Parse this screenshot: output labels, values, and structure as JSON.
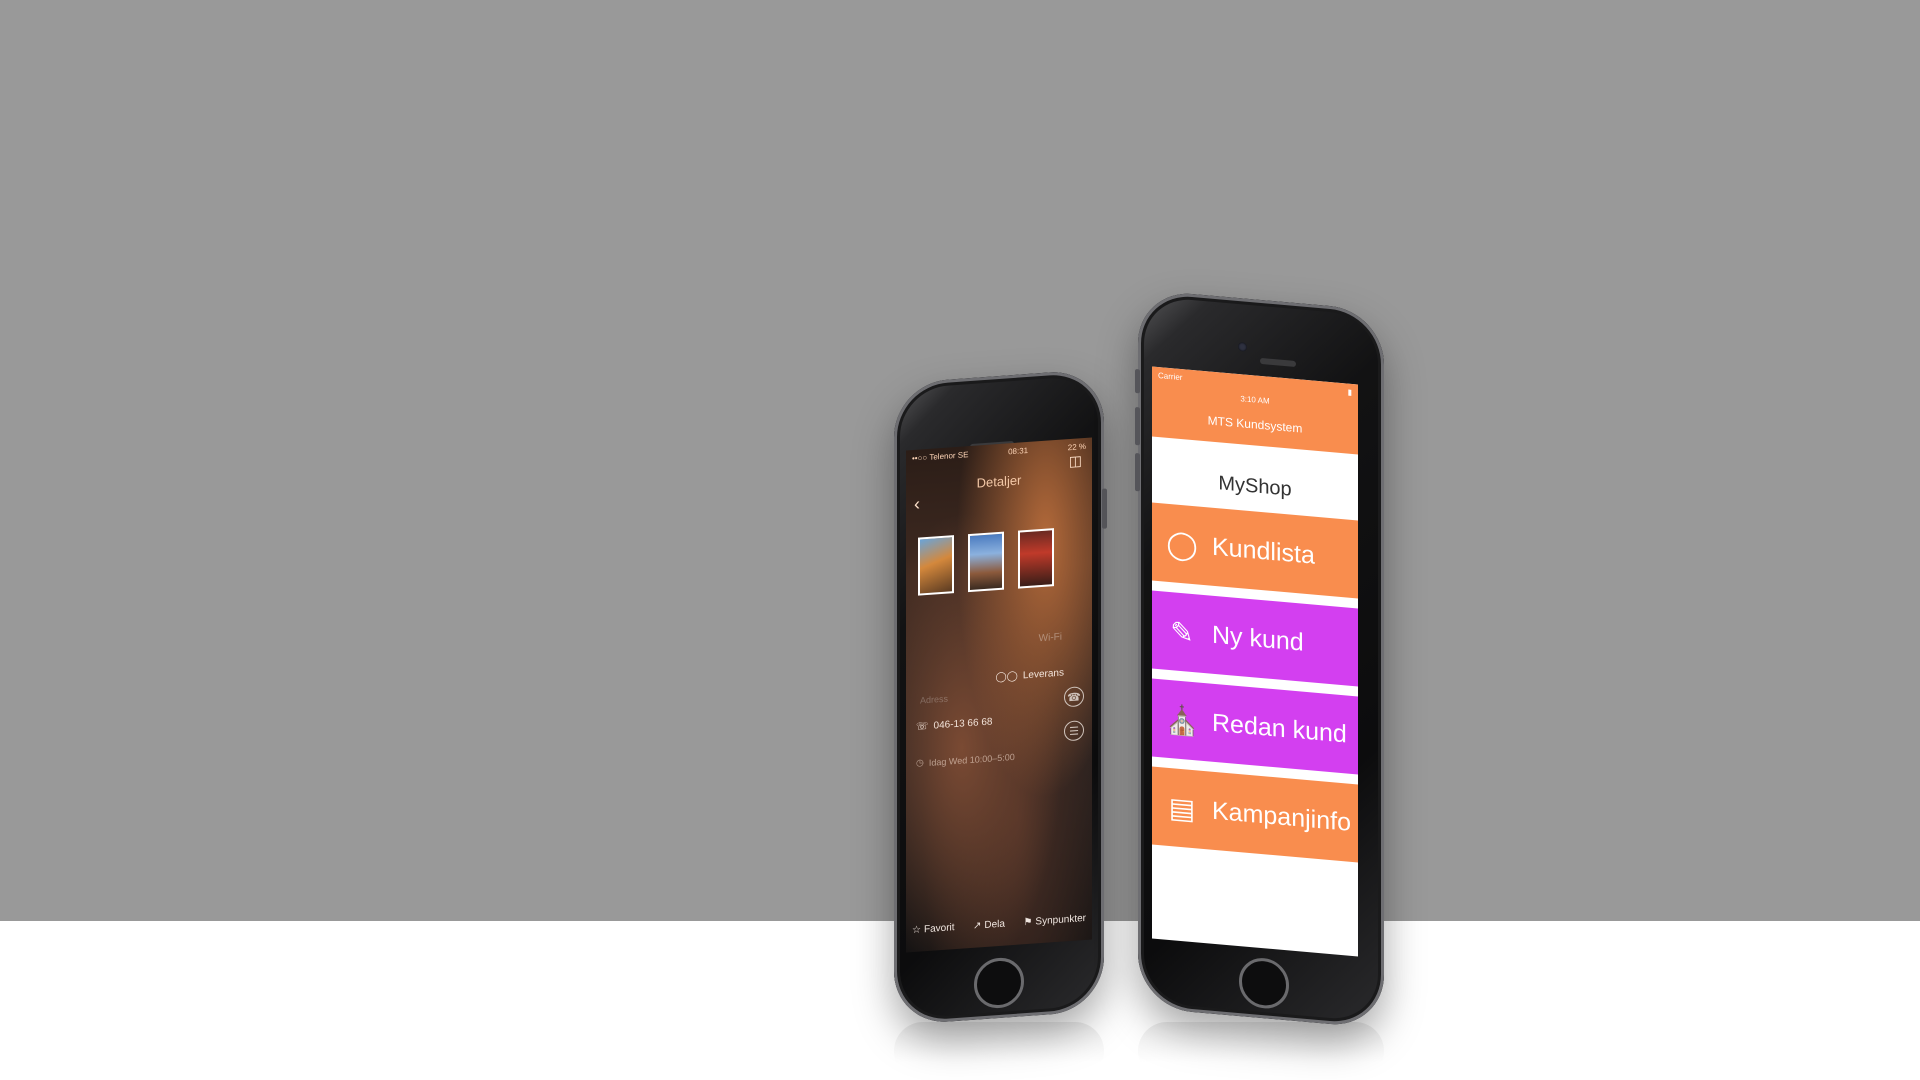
{
  "left_phone": {
    "status_left": "••○○ Telenor SE",
    "status_time": "08:31",
    "status_battery": "22 %",
    "title": "Detaljer",
    "wifi_label": "Wi-Fi",
    "leverans_label": "Leverans",
    "ghost_label": "Adress",
    "phone_number": "046-13 66 68",
    "hours": "Idag Wed 10:00–5:00",
    "toolbar": {
      "favorit": "Favorit",
      "dela": "Dela",
      "synpunkter": "Synpunkter"
    },
    "icons": {
      "back": "chevron-left-icon",
      "book": "book-icon",
      "bike": "bicycle-icon",
      "phone": "phone-icon",
      "clock": "clock-icon",
      "star": "star-icon",
      "share": "share-icon",
      "flag": "flag-icon",
      "call": "call-icon",
      "menu": "list-icon"
    }
  },
  "right_phone": {
    "status_carrier": "Carrier",
    "status_time": "3:10 AM",
    "app_title": "MTS Kundsystem",
    "shop_name": "MyShop",
    "menu": [
      {
        "label": "Kundlista",
        "icon": "user-icon",
        "color": "#f98d4e"
      },
      {
        "label": "Ny kund",
        "icon": "pencil-icon",
        "color": "#d33ff0"
      },
      {
        "label": "Redan kund",
        "icon": "store-icon",
        "color": "#d33ff0"
      },
      {
        "label": "Kampanjinfo",
        "icon": "newspaper-icon",
        "color": "#f98d4e"
      }
    ]
  },
  "colors": {
    "background": "#999999",
    "floor": "#ffffff",
    "accent_orange": "#f98d4e",
    "accent_purple": "#d33ff0"
  }
}
